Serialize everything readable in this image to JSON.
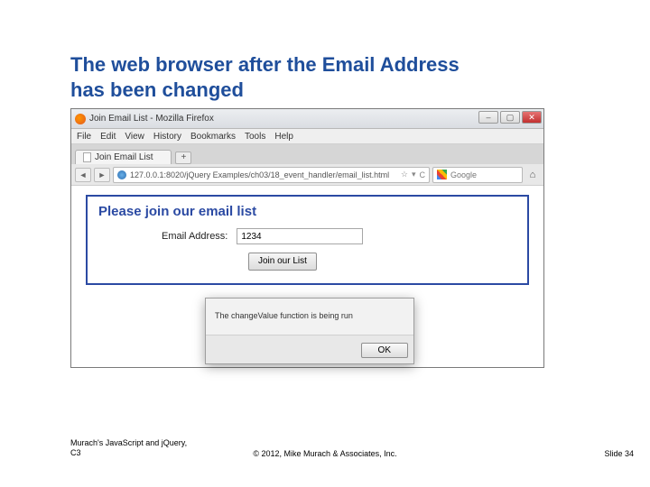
{
  "slide": {
    "title_line1": "The web browser after the Email Address",
    "title_line2": "has been changed",
    "footer_left_line1": "Murach's JavaScript and jQuery,",
    "footer_left_line2": "C3",
    "footer_center": "© 2012, Mike Murach & Associates, Inc.",
    "footer_right": "Slide 34"
  },
  "browser": {
    "window_title": "Join Email List - Mozilla Firefox",
    "menus": [
      "File",
      "Edit",
      "View",
      "History",
      "Bookmarks",
      "Tools",
      "Help"
    ],
    "tab_label": "Join Email List",
    "newtab_label": "+",
    "url": "127.0.0.1:8020/jQuery Examples/ch03/18_event_handler/email_list.html",
    "url_controls": {
      "star": "☆",
      "dropdown": "▾",
      "reload": "C"
    },
    "search_placeholder": "Google",
    "nav_back": "◄",
    "nav_fwd": "►",
    "home": "⌂",
    "winctrl": {
      "min": "–",
      "max": "▢",
      "close": "✕"
    }
  },
  "page": {
    "heading": "Please join our email list",
    "email_label": "Email Address:",
    "email_value": "1234",
    "submit_label": "Join our List"
  },
  "alert": {
    "message": "The changeValue function is being run",
    "ok": "OK"
  }
}
